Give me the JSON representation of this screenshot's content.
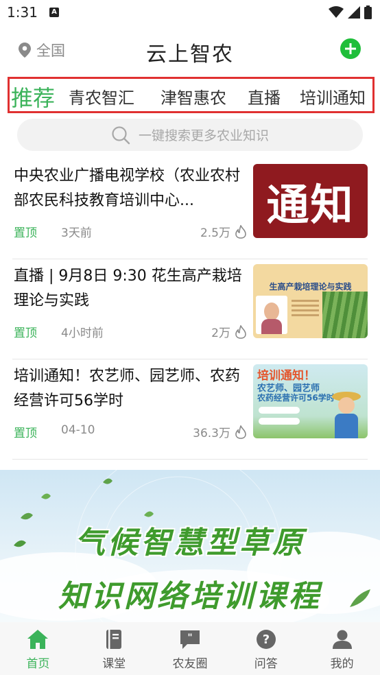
{
  "status_bar": {
    "time": "1:31",
    "notif_glyph": "A"
  },
  "header": {
    "location": "全国",
    "title": "云上智农"
  },
  "tabs": [
    {
      "label": "推荐"
    },
    {
      "label": "青农智汇"
    },
    {
      "label": "津智惠农"
    },
    {
      "label": "直播"
    },
    {
      "label": "培训通知"
    }
  ],
  "search": {
    "placeholder": "一键搜索更多农业知识"
  },
  "articles": [
    {
      "title": "中央农业广播电视学校（农业农村部农民科技教育培训中心...",
      "pin": "置顶",
      "time": "3天前",
      "views": "2.5万",
      "thumb_text": "通知"
    },
    {
      "title": "直播 | 9月8日 9:30 花生高产栽培理论与实践",
      "pin": "置顶",
      "time": "4小时前",
      "views": "2万",
      "thumb_text": "生高产栽培理论与实践"
    },
    {
      "title": "培训通知！农艺师、园艺师、农药经营许可56学时",
      "pin": "置顶",
      "time": "04-10",
      "views": "36.3万",
      "thumb_title": "培训通知！",
      "thumb_sub1": "农艺师、园艺师",
      "thumb_sub2": "农药经营许可56学时"
    }
  ],
  "banner": {
    "line1": "气候智慧型草原",
    "line2": "知识网络培训课程"
  },
  "bottom_nav": [
    {
      "label": "首页"
    },
    {
      "label": "课堂"
    },
    {
      "label": "农友圈"
    },
    {
      "label": "问答"
    },
    {
      "label": "我的"
    }
  ],
  "colors": {
    "accent": "#3bb35a",
    "add_button": "#1fbe3a",
    "tab_highlight_border": "#e03030"
  }
}
